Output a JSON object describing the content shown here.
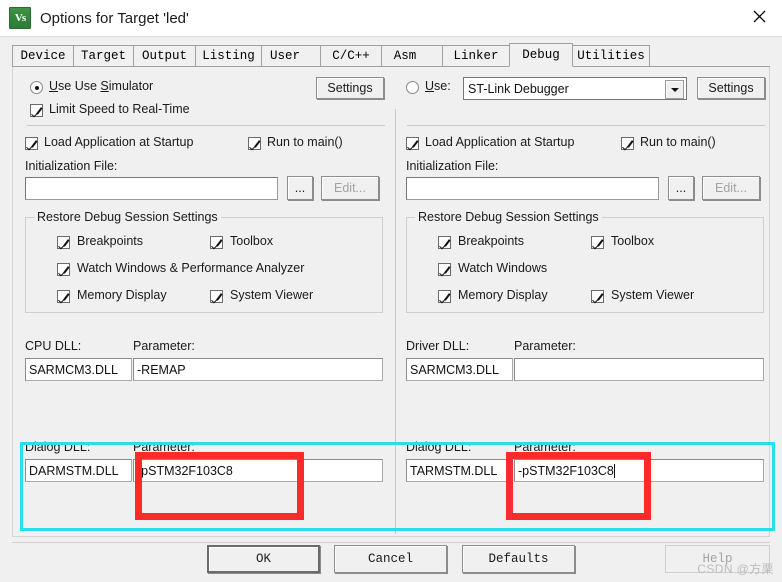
{
  "window": {
    "title": "Options for Target 'led'",
    "icon": "uvision-logo-icon",
    "close_label": "close-icon"
  },
  "tabs": [
    {
      "label": "Device",
      "active": false
    },
    {
      "label": "Target",
      "active": false
    },
    {
      "label": "Output",
      "active": false
    },
    {
      "label": "Listing",
      "active": false
    },
    {
      "label": "User",
      "active": false
    },
    {
      "label": "C/C++",
      "active": false
    },
    {
      "label": "Asm",
      "active": false
    },
    {
      "label": "Linker",
      "active": false
    },
    {
      "label": "Debug",
      "active": true
    },
    {
      "label": "Utilities",
      "active": false
    }
  ],
  "left_panel": {
    "use_simulator": {
      "label": "Use Simulator",
      "selected": true
    },
    "settings_button": "Settings",
    "limit_speed": {
      "label": "Limit Speed to Real-Time",
      "checked": true
    },
    "load_app": {
      "label": "Load Application at Startup",
      "checked": true
    },
    "run_to_main": {
      "label": "Run to main()",
      "checked": true
    },
    "init_file_label": "Initialization File:",
    "init_file_value": "",
    "browse_button": "...",
    "edit_button": "Edit...",
    "restore_group": {
      "title": "Restore Debug Session Settings",
      "items": [
        {
          "label": "Breakpoints",
          "checked": true
        },
        {
          "label": "Toolbox",
          "checked": true
        },
        {
          "label": "Watch Windows & Performance Analyzer",
          "checked": true
        },
        {
          "label": "Memory Display",
          "checked": true
        },
        {
          "label": "System Viewer",
          "checked": true
        }
      ]
    },
    "cpu_dll_label": "CPU DLL:",
    "cpu_dll_value": "SARMCM3.DLL",
    "cpu_param_label": "Parameter:",
    "cpu_param_value": "-REMAP",
    "dialog_dll_label": "Dialog DLL:",
    "dialog_dll_value": "DARMSTM.DLL",
    "dialog_param_label": "Parameter:",
    "dialog_param_value": "-pSTM32F103C8"
  },
  "right_panel": {
    "use_radio": {
      "label": "Use:",
      "selected": false
    },
    "debugger_select": "ST-Link Debugger",
    "settings_button": "Settings",
    "load_app": {
      "label": "Load Application at Startup",
      "checked": true
    },
    "run_to_main": {
      "label": "Run to main()",
      "checked": true
    },
    "init_file_label": "Initialization File:",
    "init_file_value": "",
    "browse_button": "...",
    "edit_button": "Edit...",
    "restore_group": {
      "title": "Restore Debug Session Settings",
      "items": [
        {
          "label": "Breakpoints",
          "checked": true
        },
        {
          "label": "Toolbox",
          "checked": true
        },
        {
          "label": "Watch Windows",
          "checked": true
        },
        {
          "label": "Memory Display",
          "checked": true
        },
        {
          "label": "System Viewer",
          "checked": true
        }
      ]
    },
    "driver_dll_label": "Driver DLL:",
    "driver_dll_value": "SARMCM3.DLL",
    "driver_param_label": "Parameter:",
    "driver_param_value": "",
    "dialog_dll_label": "Dialog DLL:",
    "dialog_dll_value": "TARMSTM.DLL",
    "dialog_param_label": "Parameter:",
    "dialog_param_value": "-pSTM32F103C8"
  },
  "footer": {
    "ok": "OK",
    "cancel": "Cancel",
    "defaults": "Defaults",
    "help": "Help"
  },
  "annotations": {
    "cyan_color": "#25e0e8",
    "red_color": "#fc2b2b"
  },
  "watermark": "CSDN @方栗"
}
